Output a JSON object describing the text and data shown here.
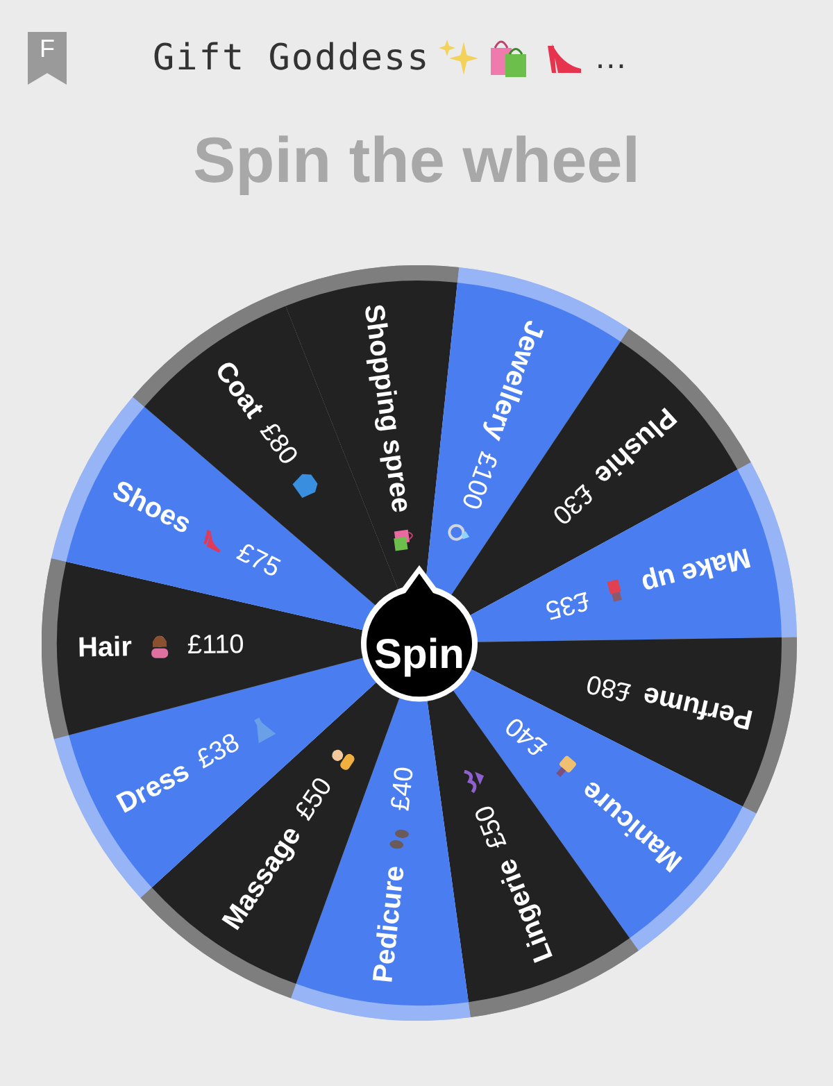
{
  "header": {
    "badge": "F",
    "title": "Gift Goddess",
    "more": "…"
  },
  "heading": "Spin the wheel",
  "wheel": {
    "segments": [
      {
        "label": "Shopping spree",
        "kind": "trailing",
        "color": "#222222"
      },
      {
        "label": "Jewellery",
        "price": "£100",
        "kind": "trailing",
        "color": "#4a7ef0"
      },
      {
        "label": "Plushie",
        "price": "£30",
        "kind": "plain",
        "color": "#222222"
      },
      {
        "label": "Make up",
        "price": "£35",
        "kind": "middle",
        "color": "#4a7ef0"
      },
      {
        "label": "Perfume",
        "price": "£80",
        "kind": "plain",
        "color": "#222222"
      },
      {
        "label": "Manicure",
        "price": "£40",
        "kind": "middle",
        "color": "#4a7ef0"
      },
      {
        "label": "Lingerie",
        "price": "£50",
        "kind": "trailing",
        "color": "#222222"
      },
      {
        "label": "Pedicure",
        "price": "£40",
        "kind": "middle",
        "color": "#4a7ef0"
      },
      {
        "label": "Massage",
        "price": "£50",
        "kind": "trailing",
        "color": "#222222"
      },
      {
        "label": "Dress",
        "price": "£38",
        "kind": "trailing",
        "color": "#4a7ef0"
      },
      {
        "label": "Hair",
        "price": "£110",
        "kind": "middle",
        "color": "#222222"
      },
      {
        "label": "Shoes",
        "price": "£75",
        "kind": "middle",
        "color": "#4a7ef0"
      },
      {
        "label": "Coat",
        "price": "£80",
        "kind": "trailing",
        "color": "#222222"
      }
    ],
    "button": "Spin"
  }
}
